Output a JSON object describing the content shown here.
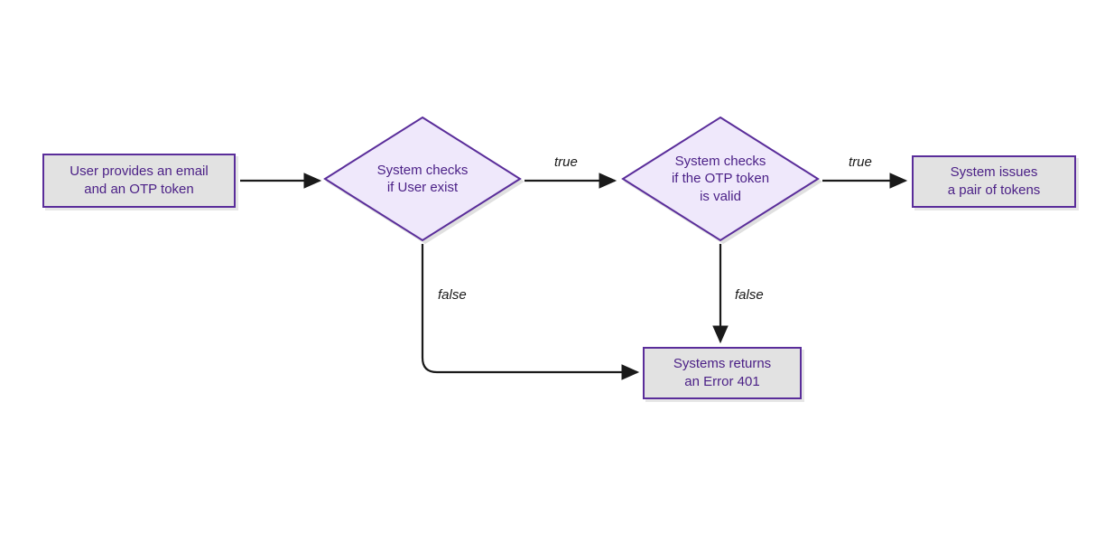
{
  "nodes": {
    "start": {
      "line1": "User provides an email",
      "line2": "and an OTP token"
    },
    "check_user": {
      "line1": "System checks",
      "line2": "if User exist"
    },
    "check_otp": {
      "line1": "System checks",
      "line2": "if the OTP token",
      "line3": "is valid"
    },
    "issue": {
      "line1": "System issues",
      "line2": "a pair of tokens"
    },
    "error": {
      "line1": "Systems returns",
      "line2": "an Error 401"
    }
  },
  "labels": {
    "true": "true",
    "false": "false"
  },
  "colors": {
    "stroke": "#5a2d9a",
    "diamond_fill": "#efe8fb",
    "box_fill": "#e2e2e2",
    "text": "#4a1f86",
    "arrow": "#1a1a1a"
  }
}
